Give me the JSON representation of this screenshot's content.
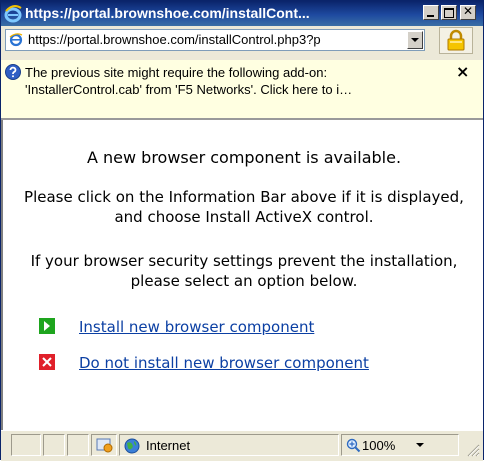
{
  "window": {
    "title": "https://portal.brownshoe.com/installCont..."
  },
  "address_bar": {
    "url": "https://portal.brownshoe.com/installControl.php3?p"
  },
  "info_bar": {
    "line1": "The previous site might require the following add-on:",
    "line2": "'InstallerControl.cab' from 'F5 Networks'. Click here to i…",
    "close_glyph": "×"
  },
  "content": {
    "heading": "A new browser component is available.",
    "paragraph1": "Please click on the Information Bar above if it is displayed, and choose Install ActiveX control.",
    "paragraph2": "If your browser security settings prevent the installation, please select an option below.",
    "options": [
      {
        "label": "Install new browser component",
        "icon": "green-arrow-icon"
      },
      {
        "label": "Do not install new browser component",
        "icon": "red-x-icon"
      }
    ]
  },
  "status_bar": {
    "zone": "Internet",
    "zoom": "100%"
  },
  "colors": {
    "link": "#0b3fa3",
    "info_bar_bg": "#ffffe1",
    "title_bar": "#0a246a"
  }
}
